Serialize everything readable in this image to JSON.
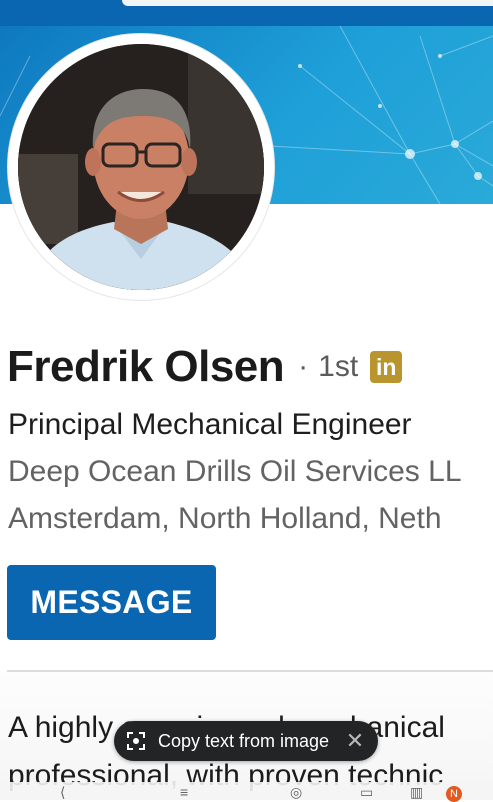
{
  "profile": {
    "name": "Fredrik Olsen",
    "degree_separator": "·",
    "degree": "1st",
    "badge_text": "in",
    "headline": "Principal Mechanical Engineer",
    "company": "Deep Ocean Drills Oil Services LL",
    "location": "Amsterdam, North Holland, Neth"
  },
  "actions": {
    "message_label": "MESSAGE"
  },
  "about": {
    "line1": "A highly experienced mechanical",
    "line2": "professional, with proven technic"
  },
  "toast": {
    "text": "Copy text from image",
    "close": "✕"
  },
  "nav": {
    "badge": "N"
  },
  "colors": {
    "brand_blue": "#0a66b0",
    "premium_gold": "#b8952d",
    "banner_blue": "#1e9fd8"
  }
}
